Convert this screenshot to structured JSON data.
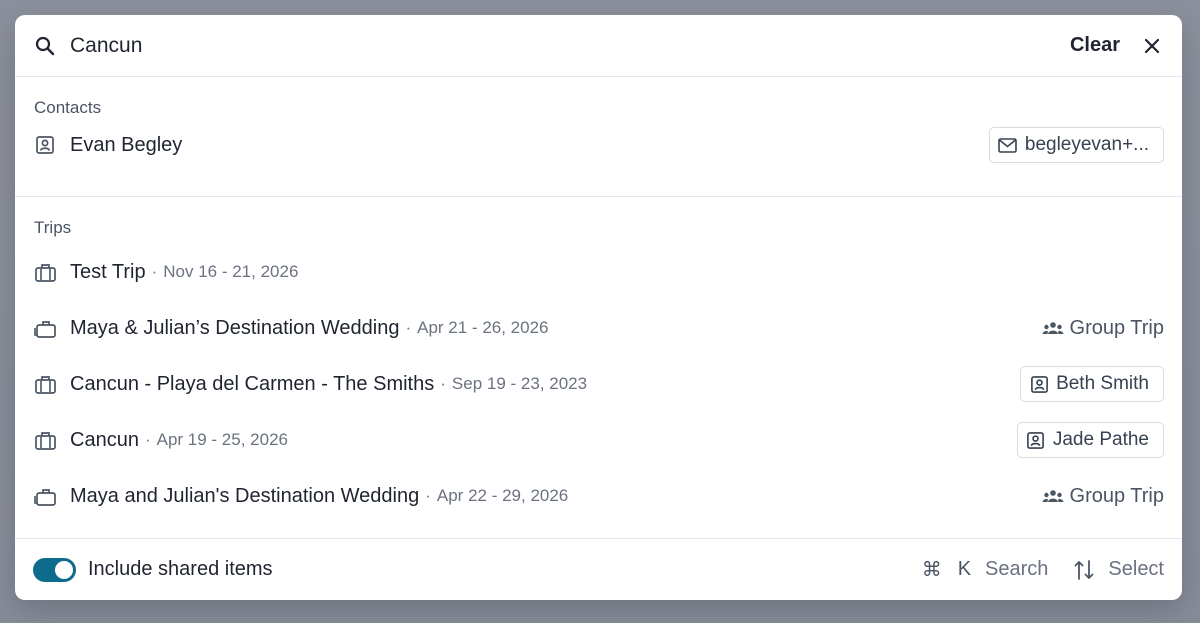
{
  "search": {
    "value": "Cancun",
    "clear_label": "Clear"
  },
  "contacts": {
    "title": "Contacts",
    "items": [
      {
        "name": "Evan Begley",
        "email": "begleyevan+..."
      }
    ]
  },
  "trips": {
    "title": "Trips",
    "items": [
      {
        "name": "Test Trip",
        "dates": "Nov 16 - 21, 2026",
        "meta_type": "none",
        "meta": ""
      },
      {
        "name": "Maya & Julian’s Destination Wedding",
        "dates": "Apr 21 - 26, 2026",
        "meta_type": "group",
        "meta": "Group Trip"
      },
      {
        "name": "Cancun - Playa del Carmen - The Smiths",
        "dates": "Sep 19 - 23, 2023",
        "meta_type": "person",
        "meta": "Beth Smith"
      },
      {
        "name": "Cancun",
        "dates": "Apr 19 - 25, 2026",
        "meta_type": "person",
        "meta": "Jade Pathe"
      },
      {
        "name": "Maya and Julian's Destination Wedding",
        "dates": "Apr 22 - 29, 2026",
        "meta_type": "group",
        "meta": "Group Trip"
      }
    ]
  },
  "footer": {
    "toggle_label": "Include shared items",
    "toggle_on": true,
    "shortcut_key_symbol": "⌘",
    "shortcut_key": "K",
    "shortcut_label": "Search",
    "select_label": "Select"
  },
  "colors": {
    "accent": "#0e6b8c",
    "backdrop": "#8a8f9c"
  }
}
